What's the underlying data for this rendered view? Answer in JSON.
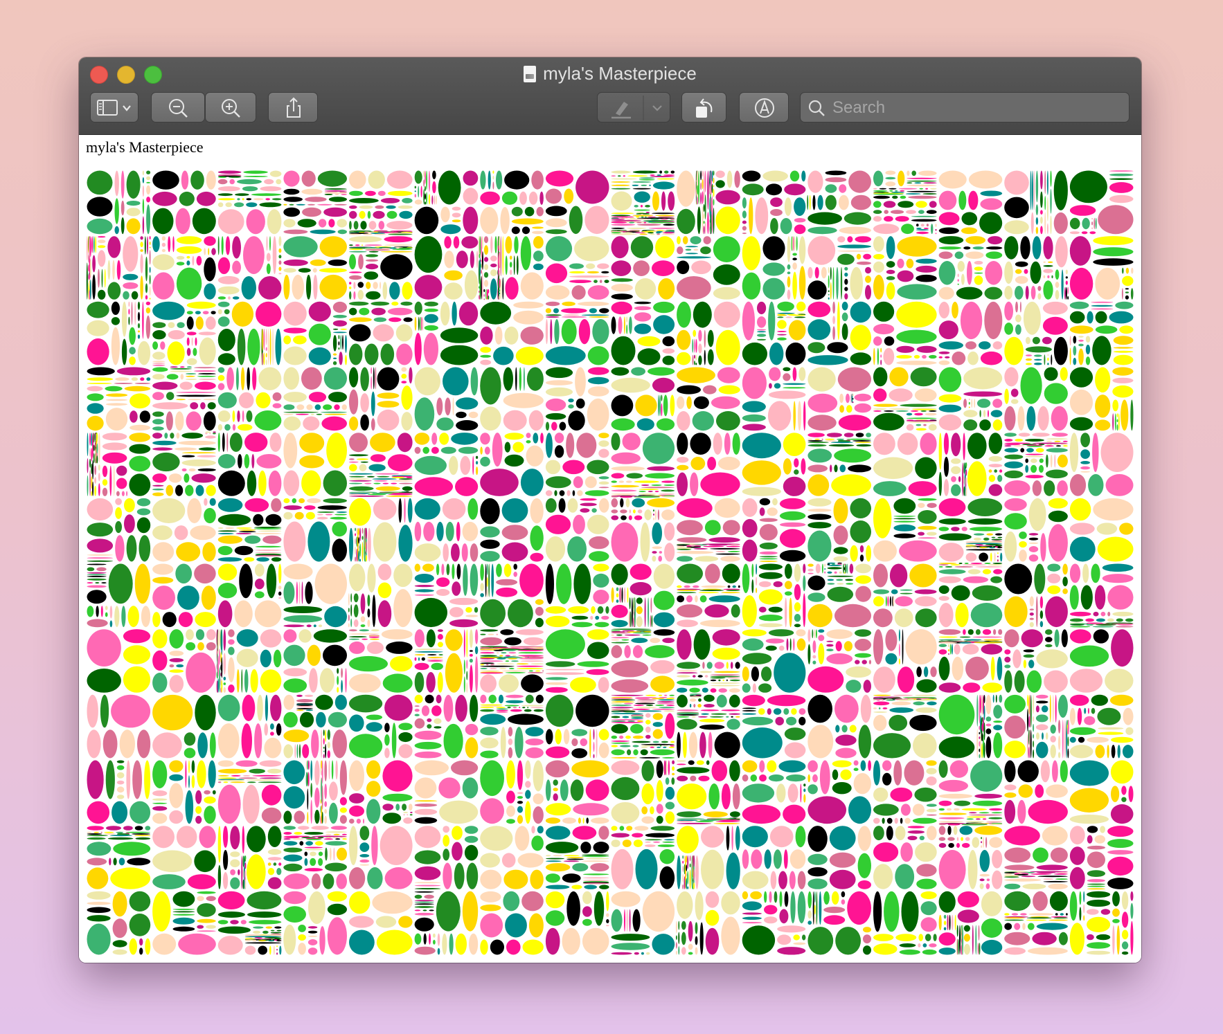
{
  "window": {
    "title": "myla's Masterpiece"
  },
  "toolbar": {
    "sidebar_label": "Sidebar",
    "zoom_out_label": "Zoom Out",
    "zoom_in_label": "Zoom In",
    "share_label": "Share",
    "highlight_label": "Highlight",
    "rotate_label": "Rotate",
    "markup_label": "Markup",
    "search_placeholder": "Search"
  },
  "page": {
    "heading": "myla's Masterpiece"
  },
  "artwork": {
    "palette": [
      "#000000",
      "#228b22",
      "#3cb371",
      "#006400",
      "#32cd32",
      "#ffb6c1",
      "#ff69b4",
      "#ff1493",
      "#c71585",
      "#db7093",
      "#008b8b",
      "#ffd700",
      "#ffff00",
      "#ffdab9",
      "#eee8aa"
    ],
    "background_color": "#ffffff"
  }
}
